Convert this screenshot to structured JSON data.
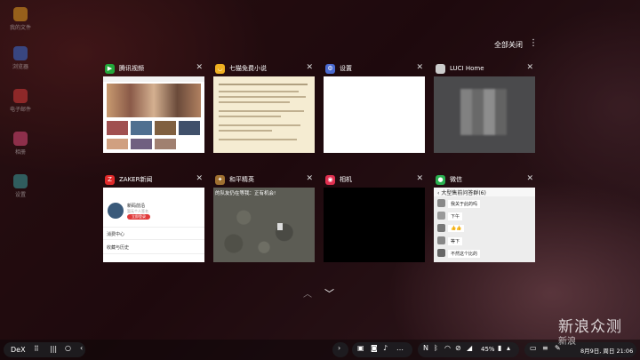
{
  "desktop_icons": [
    {
      "label": "我的文件",
      "color": "#e8a020"
    },
    {
      "label": "浏览器",
      "color": "#3a6fd8"
    },
    {
      "label": "电子邮件",
      "color": "#d83a3a"
    },
    {
      "label": "相册",
      "color": "#e04a7a"
    },
    {
      "label": "设置",
      "color": "#3aa0a0"
    }
  ],
  "header": {
    "close_all": "全部关闭"
  },
  "cards": [
    {
      "title": "腾讯视频",
      "icon_color": "#22a83a"
    },
    {
      "title": "七猫免费小说",
      "icon_color": "#f0b020"
    },
    {
      "title": "设置",
      "icon_color": "#4a6ad0"
    },
    {
      "title": "LUCI Home",
      "icon_color": "#cccccc"
    },
    {
      "title": "ZAKER新闻",
      "icon_color": "#e02a2a"
    },
    {
      "title": "和平精英",
      "icon_color": "#a07030"
    },
    {
      "title": "相机",
      "icon_color": "#e03050"
    },
    {
      "title": "微信",
      "icon_color": "#2ab050"
    }
  ],
  "zaker": {
    "name": "新码前沿",
    "sub": "暂无个人签名",
    "button": "立即登录",
    "item1": "消费中心",
    "item2": "收藏与历史"
  },
  "game": {
    "banner": "的队友仍在等我：正有机会!"
  },
  "wechat": {
    "chat_title": "大型售前问答群(6)",
    "messages": [
      "我关于此的吗",
      "下午",
      "👍👍",
      "等下",
      "不然这个比的"
    ]
  },
  "taskbar": {
    "dex": "DeX",
    "battery": "45%",
    "date": "8月9日, 周日 21:06"
  },
  "watermark": {
    "line1": "新浪众测",
    "line2": "新浪"
  }
}
